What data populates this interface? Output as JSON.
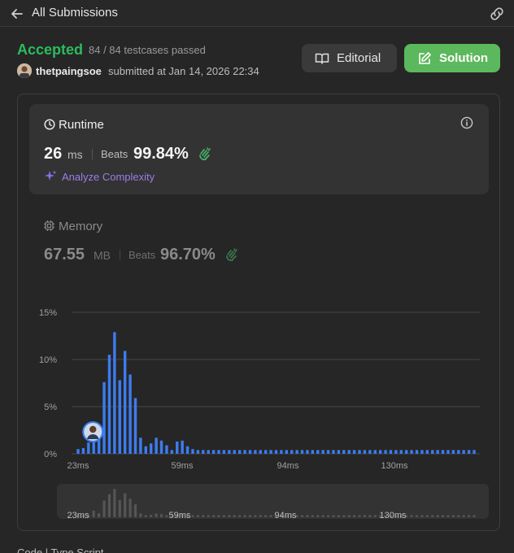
{
  "header": {
    "title": "All Submissions",
    "back_icon": "arrow-left-icon",
    "link_icon": "link-icon"
  },
  "submission": {
    "status": "Accepted",
    "testcases": "84 / 84 testcases passed",
    "user": "thetpaingsoe",
    "submitted_text": "submitted at Jan 14, 2026 22:34"
  },
  "buttons": {
    "editorial": "Editorial",
    "solution": "Solution"
  },
  "runtime": {
    "title": "Runtime",
    "value": "26",
    "unit": "ms",
    "beats_label": "Beats",
    "beats": "99.84%",
    "analyze": "Analyze Complexity"
  },
  "memory": {
    "title": "Memory",
    "value": "67.55",
    "unit": "MB",
    "beats_label": "Beats",
    "beats": "96.70%"
  },
  "colors": {
    "accepted": "#2cbb5d",
    "solution_btn": "#5cb85c",
    "bar": "#3d7cf0",
    "analyze": "#9b7de8"
  },
  "chart_data": {
    "type": "bar",
    "yticks": [
      "15%",
      "10%",
      "5%",
      "0%"
    ],
    "ylim": [
      0,
      15
    ],
    "xticks": [
      "23ms",
      "59ms",
      "94ms",
      "130ms"
    ],
    "x_start_ms": 20,
    "x_step_ms": 1.78,
    "highlight_ms": 26,
    "values": [
      0.5,
      0.6,
      1.2,
      3.0,
      1.8,
      7.6,
      10.5,
      12.9,
      7.8,
      10.9,
      8.4,
      5.9,
      1.7,
      0.8,
      1.1,
      1.7,
      1.4,
      0.9,
      0.4,
      1.3,
      1.4,
      0.8,
      0.5,
      0.4,
      0.4,
      0.4,
      0.4,
      0.4,
      0.4,
      0.4,
      0.4,
      0.4,
      0.4,
      0.4,
      0.4,
      0.4,
      0.4,
      0.4,
      0.4,
      0.4,
      0.4,
      0.4,
      0.4,
      0.4,
      0.4,
      0.4,
      0.4,
      0.4,
      0.4,
      0.4,
      0.4,
      0.4,
      0.4,
      0.4,
      0.4,
      0.4,
      0.4,
      0.4,
      0.4,
      0.4,
      0.4,
      0.4,
      0.4,
      0.4,
      0.4,
      0.4,
      0.4,
      0.4,
      0.4,
      0.4,
      0.4,
      0.4,
      0.4,
      0.4,
      0.4,
      0.4,
      0.4
    ],
    "mini_xticks": [
      "23ms",
      "59ms",
      "94ms",
      "130ms"
    ]
  },
  "bottom": {
    "label": "Code | Type Script"
  }
}
